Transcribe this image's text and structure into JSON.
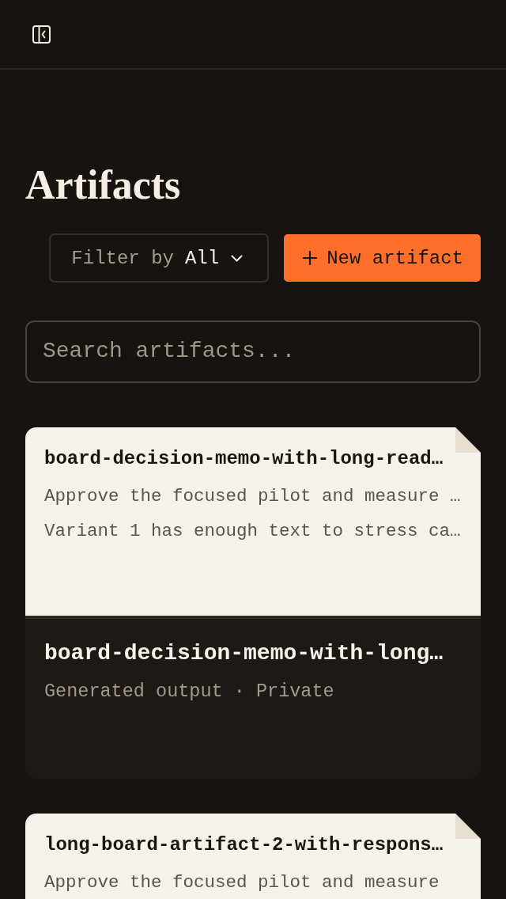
{
  "page_title": "Artifacts",
  "filter": {
    "label": "Filter by",
    "value": "All"
  },
  "new_button": {
    "label": "New artifact"
  },
  "search": {
    "placeholder": "Search artifacts..."
  },
  "artifacts": [
    {
      "preview_title": "board-decision-memo-with-long-read…",
      "preview_lines": [
        "Approve the focused pilot and measure …",
        "Variant 1 has enough text to stress ca…"
      ],
      "title": "board-decision-memo-with-long…",
      "meta": "Generated output · Private"
    },
    {
      "preview_title": "long-board-artifact-2-with-respons…",
      "preview_lines": [
        "Approve the focused pilot and measure"
      ]
    }
  ]
}
